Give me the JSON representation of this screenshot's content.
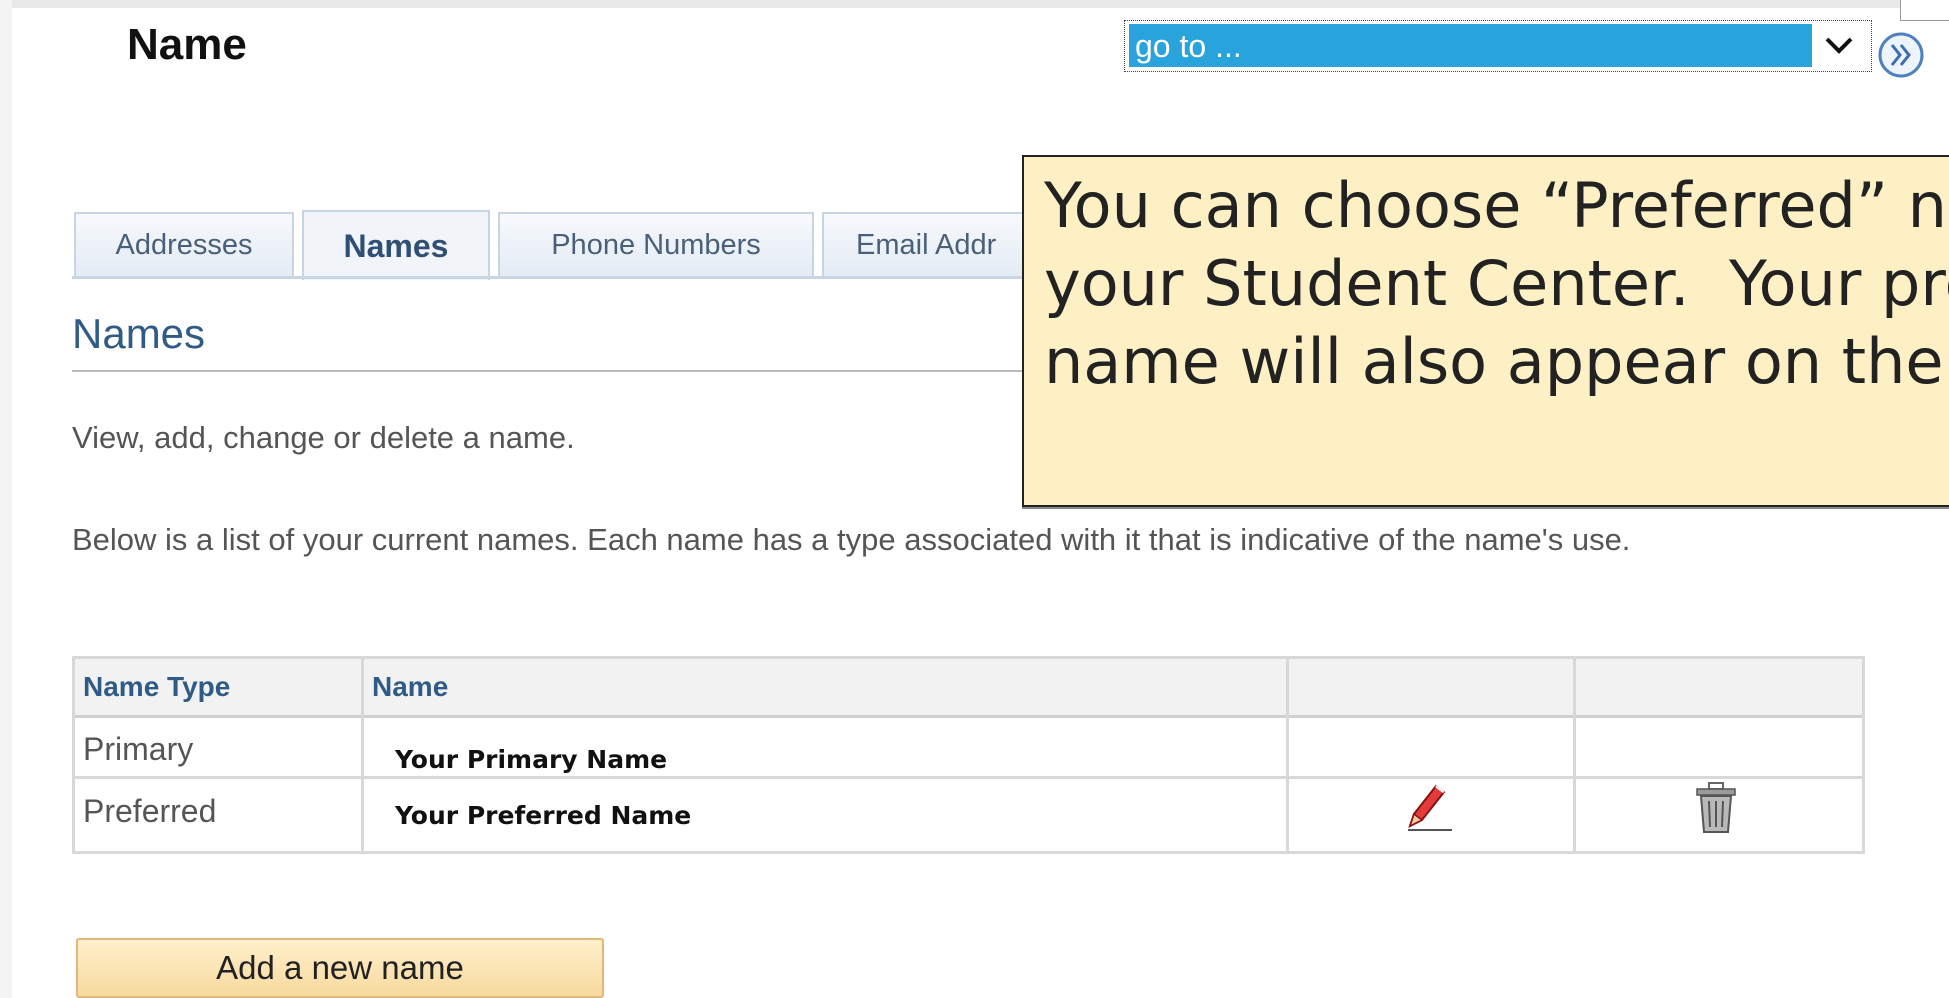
{
  "header": {
    "title": "Name",
    "goto": {
      "selected": "go to ..."
    },
    "go_button_icon": "double-chevron-right-icon"
  },
  "tabs": [
    {
      "label": "Addresses",
      "active": false
    },
    {
      "label": "Names",
      "active": true
    },
    {
      "label": "Phone Numbers",
      "active": false
    },
    {
      "label": "Email Addr",
      "active": false
    }
  ],
  "section": {
    "title": "Names",
    "intro": "View, add, change or delete a name.",
    "description": "Below is a list of your current names. Each name has a type associated with it that is indicative of the name's use."
  },
  "table": {
    "headers": [
      "Name Type",
      "Name",
      "",
      ""
    ],
    "rows": [
      {
        "type": "Primary",
        "name": "Your Primary Name",
        "editable": false,
        "deletable": false
      },
      {
        "type": "Preferred",
        "name": "Your Preferred Name",
        "editable": true,
        "deletable": true,
        "edit_icon": "pencil-icon",
        "delete_icon": "trash-icon"
      }
    ]
  },
  "actions": {
    "add_label": "Add a new name"
  },
  "callout": {
    "text": "You can choose “Preferred” na\nyour Student Center.  Your pre\nname will also appear on the I"
  },
  "colors": {
    "goto_highlight": "#29a3dc",
    "callout_bg": "#fdf0c4",
    "header_text": "#2f5b86",
    "button_bg": "#f7d99e"
  }
}
